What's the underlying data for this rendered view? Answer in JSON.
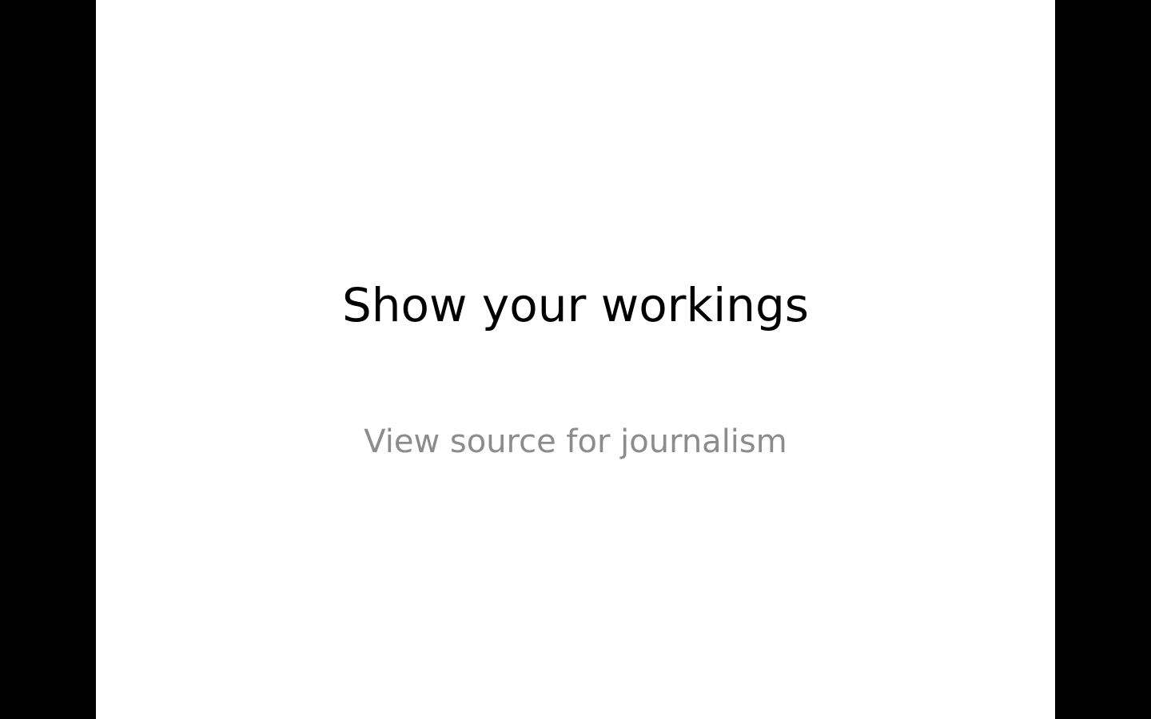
{
  "slide": {
    "title": "Show your workings",
    "subtitle": "View source for journalism"
  },
  "colors": {
    "background": "#000000",
    "slide": "#ffffff",
    "title": "#000000",
    "subtitle": "#8c8c8c"
  }
}
